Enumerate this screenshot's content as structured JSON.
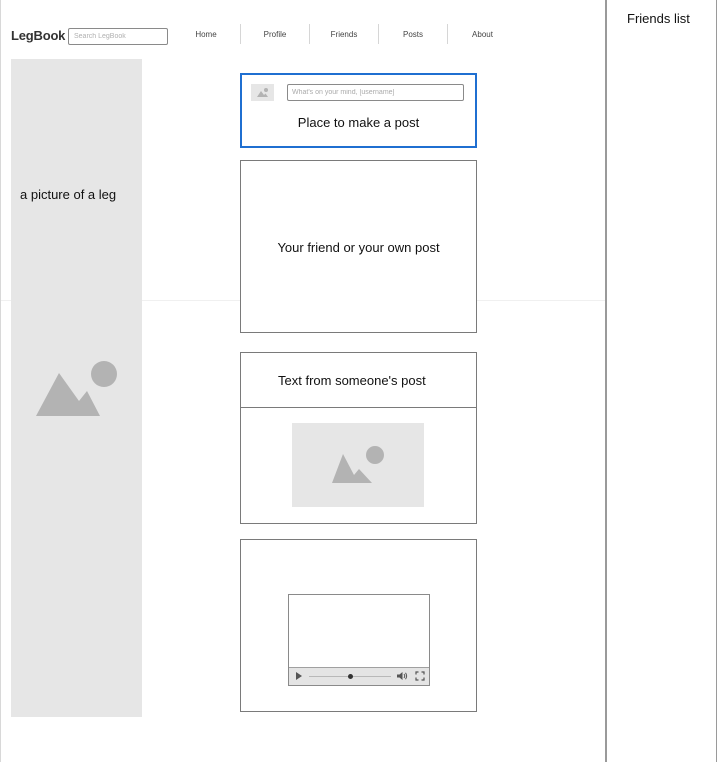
{
  "header": {
    "logo": "LegBook",
    "search_placeholder": "Search LegBook",
    "nav": [
      "Home",
      "Profile",
      "Friends",
      "Posts",
      "About"
    ]
  },
  "left_panel": {
    "caption": "a picture of a leg",
    "image_icon": "image-placeholder-icon"
  },
  "composer": {
    "avatar_icon": "image-placeholder-icon",
    "input_placeholder": "What's on your mind, [username]",
    "label": "Place to make a post"
  },
  "posts": [
    {
      "label": "Your friend or your own post"
    },
    {
      "label": "Text from someone's post",
      "image_icon": "image-placeholder-icon"
    },
    {
      "video": {
        "controls": [
          "play-icon",
          "seek-slider",
          "volume-icon",
          "fullscreen-icon"
        ],
        "progress": 0.5
      }
    }
  ],
  "friends_list": {
    "title": "Friends list"
  },
  "colors": {
    "accent_border": "#1f6fd1",
    "placeholder_bg": "#e6e6e6",
    "placeholder_icon": "#b3b3b3"
  }
}
